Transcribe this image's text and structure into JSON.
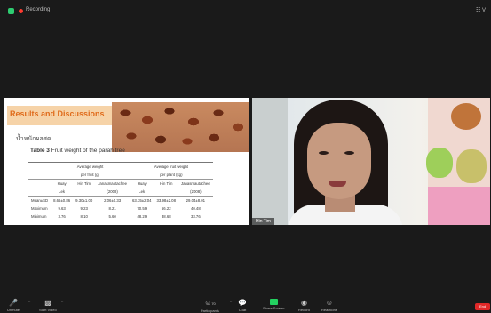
{
  "topbar": {
    "recording_label": "Recording",
    "view_label": "☷ V"
  },
  "slide": {
    "title": "Results and Discussions",
    "thai_label": "น้ำหนักผลสด",
    "table_caption_bold": "Table 3",
    "table_caption_rest": " Fruit weight of the parah tree",
    "group_headers": [
      "Average weight",
      "Average fruit weight"
    ],
    "group_subheaders": [
      "per fruit (g)",
      "per plant (kg)"
    ],
    "columns": [
      "Huay",
      "Hin Tim",
      "Janasmautachee",
      "Huay",
      "Hin Tim",
      "Janasmautachee"
    ],
    "columns_sub": [
      "Lek",
      "",
      "(2008)",
      "Lek",
      "",
      "(2008)"
    ],
    "rows": [
      {
        "label": "Mean±SD",
        "values": [
          "8.66±0.86",
          "9.30±1.00",
          "2.06±0.33",
          "63.35±2.04",
          "33.98±2.08",
          "29.04±8.01"
        ]
      },
      {
        "label": "Maximum",
        "values": [
          "9.63",
          "9.23",
          "8.21",
          "70.59",
          "66.22",
          "40.48"
        ]
      },
      {
        "label": "Minimum",
        "values": [
          "3.76",
          "8.10",
          "5.60",
          "48.29",
          "38.68",
          "33.76"
        ]
      }
    ]
  },
  "video": {
    "name": "Hin Tim"
  },
  "toolbar": {
    "unmute": "Unmute",
    "start_video": "Start Video",
    "participants": "Participants",
    "participants_count": "70",
    "chat": "Chat",
    "share_screen": "Share Screen",
    "record": "Record",
    "reactions": "Reactions",
    "end": "End"
  }
}
